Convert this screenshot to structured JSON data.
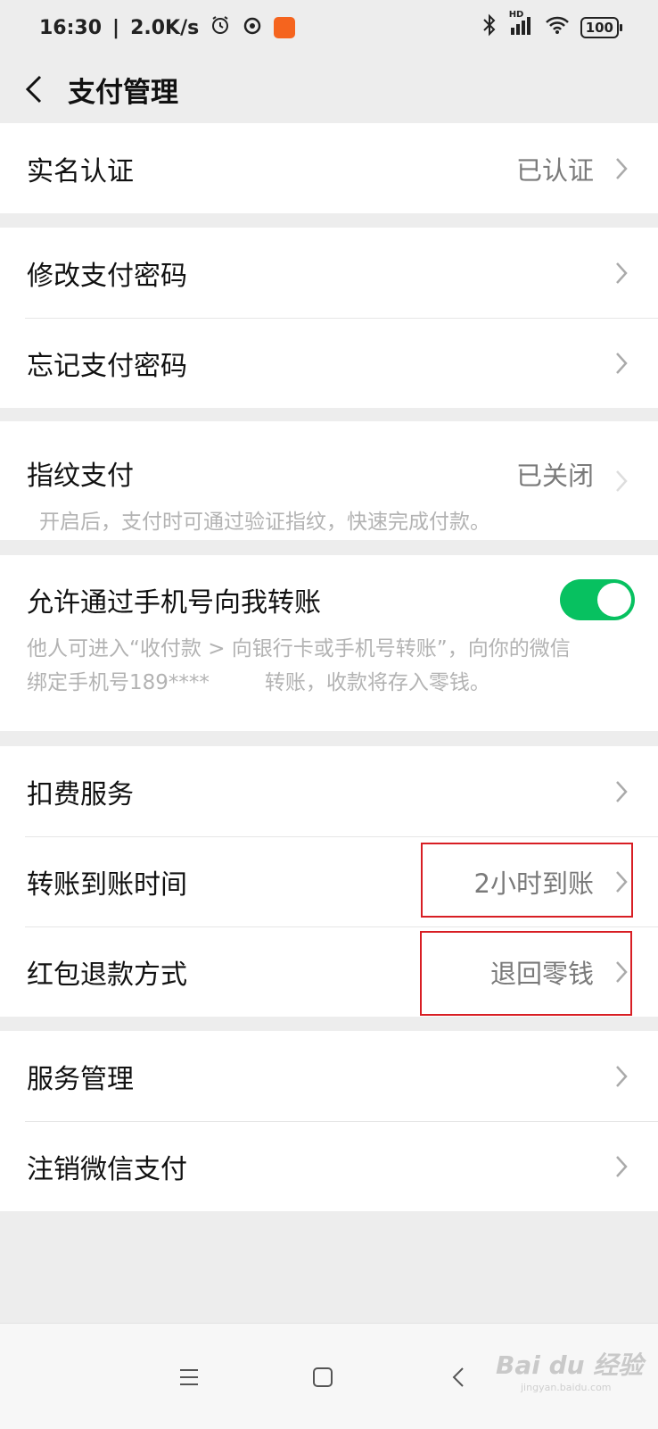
{
  "status_bar": {
    "time": "16:30",
    "speed": "2.0K/s",
    "battery": "100",
    "signal_badge": "HD"
  },
  "header": {
    "title": "支付管理"
  },
  "groups": {
    "identity": {
      "label": "实名认证",
      "value": "已认证"
    },
    "password": {
      "change_label": "修改支付密码",
      "forgot_label": "忘记支付密码"
    },
    "fingerprint": {
      "label": "指纹支付",
      "value": "已关闭",
      "desc": "开启后，支付时可通过验证指纹，快速完成付款。"
    },
    "phone_transfer": {
      "label": "允许通过手机号向我转账",
      "enabled": true,
      "desc_line1": "他人可进入“收付款 > 向银行卡或手机号转账”，向你的微信",
      "desc_line2_prefix": "绑定手机号189****",
      "desc_line2_suffix": "转账，收款将存入零钱。"
    },
    "services": {
      "deduction_label": "扣费服务",
      "arrival_label": "转账到账时间",
      "arrival_value": "2小时到账",
      "refund_label": "红包退款方式",
      "refund_value": "退回零钱"
    },
    "manage": {
      "service_label": "服务管理",
      "cancel_label": "注销微信支付"
    }
  },
  "watermark": {
    "brand": "Bai du 经验",
    "url": "jingyan.baidu.com"
  },
  "colors": {
    "toggle_on": "#07c160",
    "highlight": "#d81e24",
    "page_bg": "#ededed"
  }
}
